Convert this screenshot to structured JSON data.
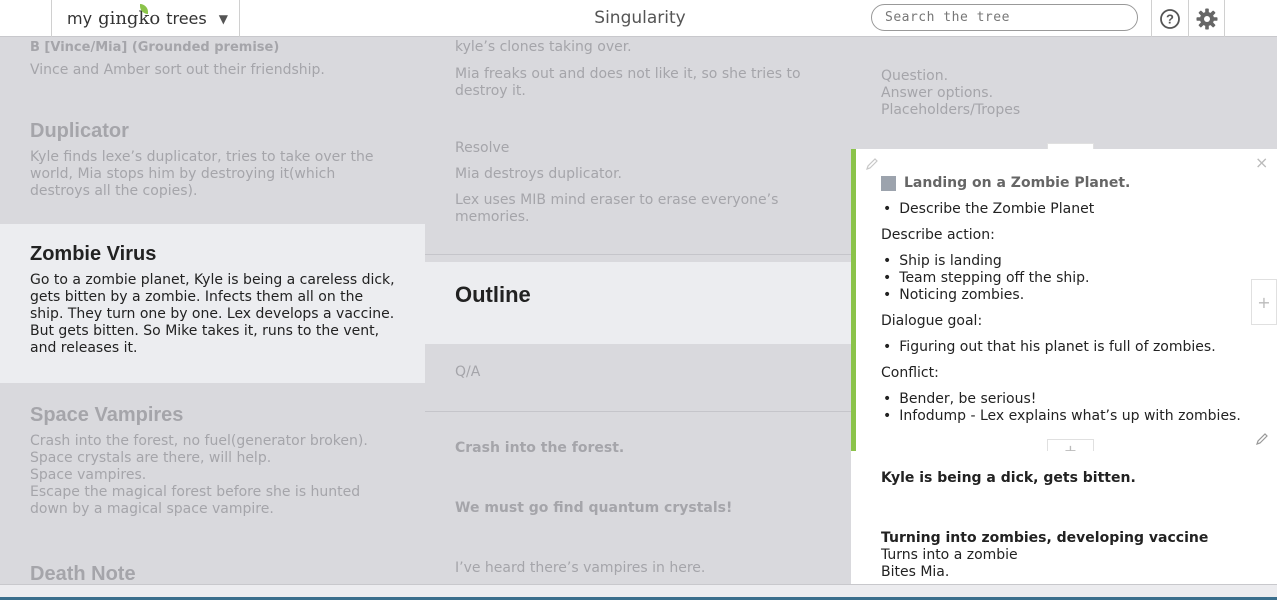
{
  "header": {
    "logo_my": "my",
    "logo_gingko": "gingko",
    "logo_trees": "trees",
    "logo_caret": "▼",
    "doc_title": "Singularity",
    "search_placeholder": "Search the tree",
    "help_icon": "question-circle",
    "settings_icon": "gear"
  },
  "col1": {
    "cards": [
      {
        "title": "",
        "subtitle": "B [Vince/Mia] (Grounded premise)",
        "body": "Vince and Amber sort out their friendship."
      },
      {
        "title": "Duplicator",
        "body": "Kyle finds lexe’s duplicator, tries to take over the world, Mia stops him by destroying it(which destroys all the copies)."
      },
      {
        "title": "Zombie Virus",
        "body": "Go to a zombie planet, Kyle is being a careless dick, gets bitten by a zombie. Infects them all on the ship. They turn one by one. Lex develops a vaccine. But gets bitten. So Mike takes it, runs to the vent, and releases it."
      },
      {
        "title": "Space Vampires",
        "lines": [
          "Crash into the forest, no fuel(generator broken).",
          "Space crystals are there, will help.",
          "Space vampires.",
          "Escape the magical forest before she is hunted down by a magical space vampire."
        ]
      },
      {
        "title": "Death Note"
      }
    ]
  },
  "col2": {
    "cards": [
      {
        "lines": [
          "kyle’s clones taking over.",
          "Mia freaks out and does not like it, so she tries to destroy it."
        ]
      },
      {
        "lines": [
          "Resolve",
          "Mia destroys duplicator.",
          "Lex uses MIB mind eraser to erase everyone’s memories."
        ]
      },
      {
        "title": "Outline"
      },
      {
        "lines": [
          "Q/A"
        ]
      },
      {
        "bold_lines": [
          "Crash into the forest.",
          "We must go find quantum crystals!"
        ],
        "lines": [
          "I’ve heard there’s vampires in here."
        ]
      }
    ]
  },
  "col3": {
    "top_lines": [
      "Question.",
      "Answer options.",
      "Placeholders/Tropes"
    ],
    "editor": {
      "title": "Landing on a Zombie Planet.",
      "bullet1": "Describe the Zombie Planet",
      "label_action": "Describe action:",
      "action_items": [
        "Ship is landing",
        "Team stepping off the ship.",
        "Noticing zombies."
      ],
      "label_dialogue": "Dialogue goal:",
      "dialogue_items": [
        "Figuring out that his planet is full of zombies."
      ],
      "label_conflict": "Conflict:",
      "conflict_items": [
        "Bender, be serious!",
        "Infodump - Lex explains what’s up with zombies."
      ]
    },
    "below": {
      "bold1": "Kyle is being a dick, gets bitten.",
      "bold2": "Turning into zombies, developing vaccine",
      "lines": [
        "Turns into a zombie",
        "Bites Mia."
      ]
    },
    "plus": "+",
    "close": "×"
  },
  "colors": {
    "accent": "#8bc34a",
    "active_card": "#ecedf0",
    "inactive_text": "#a5a5aa",
    "bg": "#d9d9dd"
  }
}
